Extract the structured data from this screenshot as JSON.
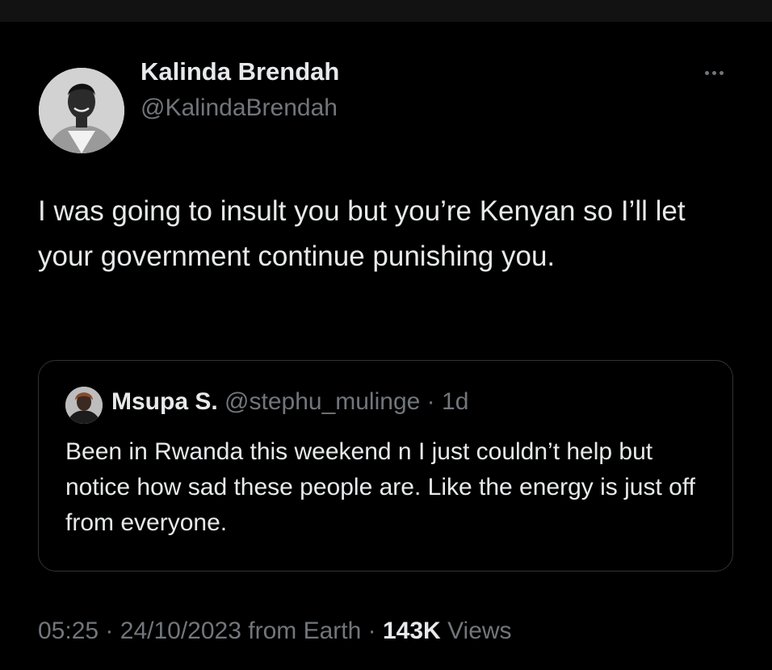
{
  "tweet": {
    "author": {
      "display_name": "Kalinda Brendah",
      "handle": "@KalindaBrendah"
    },
    "text": "I was going to insult you but you’re Kenyan so I’ll let your government continue punishing you.",
    "more_icon": "more-horizontal-icon",
    "quoted": {
      "display_name": "Msupa S.",
      "handle": "@stephu_mulinge",
      "separator": "·",
      "age": "1d",
      "text": "Been in Rwanda this weekend n I just couldn’t help but notice how sad these people are. Like the energy is just off from everyone."
    },
    "meta": {
      "time": "05:25",
      "separator": "·",
      "date": "24/10/2023",
      "source": "from Earth",
      "views_count": "143K",
      "views_label": "Views"
    }
  },
  "colors": {
    "background": "#000000",
    "top_bar": "#121212",
    "primary_text": "#e7e9ea",
    "secondary_text": "#71767b",
    "border": "#2f3336"
  }
}
